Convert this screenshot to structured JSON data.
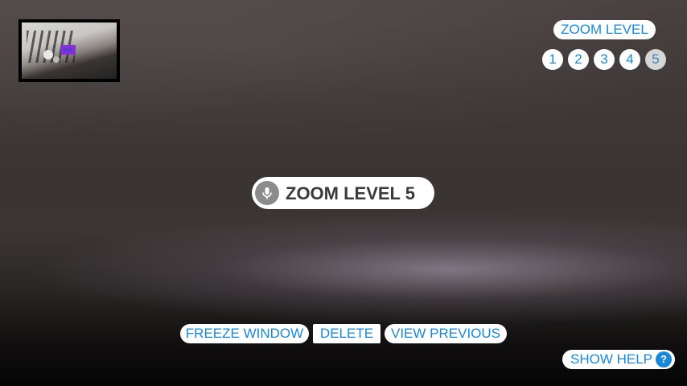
{
  "zoom_panel": {
    "label": "ZOOM LEVEL",
    "levels": [
      "1",
      "2",
      "3",
      "4",
      "5"
    ],
    "active_level": "5"
  },
  "voice_indicator": {
    "text": "ZOOM LEVEL 5",
    "icon": "microphone-icon"
  },
  "actions": {
    "freeze_window": "FREEZE WINDOW",
    "delete": "DELETE",
    "view_previous": "VIEW PREVIOUS"
  },
  "help": {
    "label": "SHOW HELP",
    "icon_glyph": "?"
  },
  "colors": {
    "accent": "#1a88d8",
    "pill_background": "#ffffff",
    "active_level_background": "#d6d6d6",
    "viewport_frame": "#8e2bdb"
  }
}
